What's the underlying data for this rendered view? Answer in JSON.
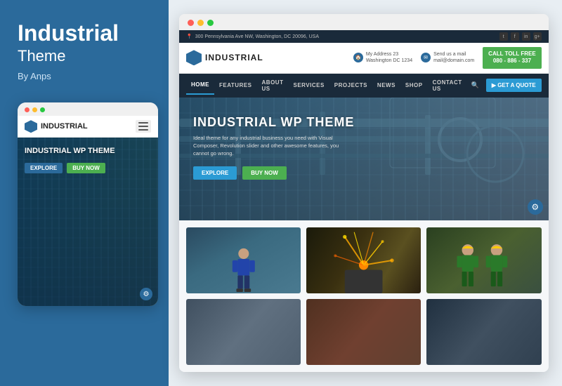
{
  "left": {
    "title": "Industrial",
    "subtitle": "Theme",
    "by": "By Anps"
  },
  "mobile": {
    "logo": "INDUSTRIAL",
    "hero_title": "INDUSTRIAL WP THEME",
    "btn_explore": "EXPLORE",
    "btn_buy": "BUY NOW"
  },
  "desktop": {
    "dots": [
      "red",
      "yellow",
      "green"
    ],
    "topbar": {
      "address": "300 Pennsylvania Ave NW, Washington, DC 20096, USA",
      "socials": [
        "t",
        "f",
        "in",
        "g+"
      ]
    },
    "header": {
      "logo": "INDUSTRIAL",
      "info1_label": "My Address 23",
      "info1_sub": "Washington DC 1234",
      "info2_label": "Send us a mail",
      "info2_sub": "mail@domain.com",
      "call_label": "CALL TOLL FREE",
      "call_number": "080 - 886 - 337"
    },
    "nav": {
      "items": [
        "HOME",
        "FEATURES",
        "ABOUT US",
        "SERVICES",
        "PROJECTS",
        "NEWS",
        "SHOP",
        "CONTACT US"
      ],
      "cta": "GET A QUOTE"
    },
    "hero": {
      "title": "INDUSTRIAL WP THEME",
      "desc": "Ideal theme for any industrial business you need with Visual Composer, Revolution slider and other awesome features, you cannot go wrong.",
      "btn_explore": "EXPLORE",
      "btn_buy": "BUY NOW"
    },
    "cards": [
      {
        "id": 1,
        "style": "worker-blue"
      },
      {
        "id": 2,
        "style": "sparks"
      },
      {
        "id": 3,
        "style": "workers-yellow"
      },
      {
        "id": 4,
        "style": "machine"
      },
      {
        "id": 5,
        "style": "factory"
      },
      {
        "id": 6,
        "style": "pipes"
      }
    ]
  }
}
